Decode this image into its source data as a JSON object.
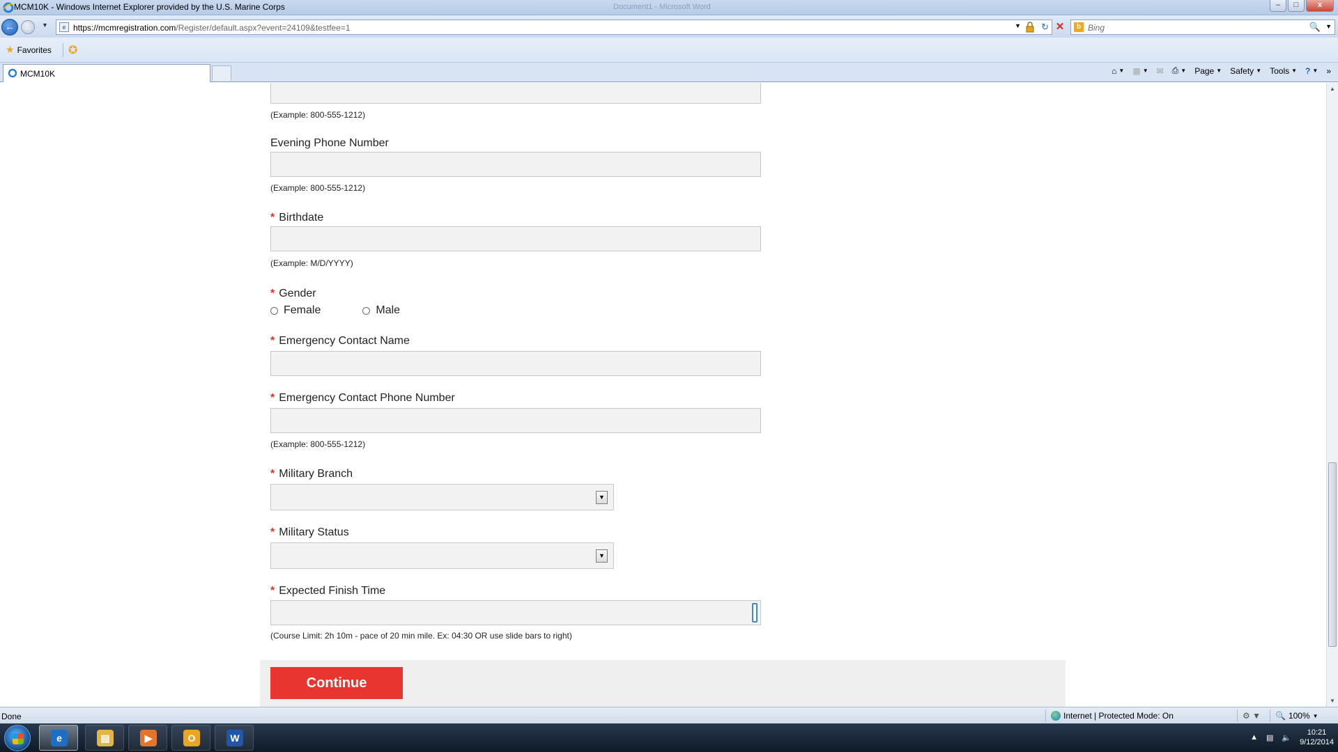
{
  "window": {
    "title": "MCM10K - Windows Internet Explorer provided by the U.S. Marine Corps",
    "ghost_title": "Document1 - Microsoft Word",
    "minimize": "–",
    "maximize": "□",
    "close": "x"
  },
  "address_bar": {
    "url_main": "https://mcmregistration.com",
    "url_rest": "/Register/default.aspx?event=24109&testfee=1",
    "search_placeholder": "Bing"
  },
  "favorites_bar": {
    "favorites_label": "Favorites"
  },
  "tabs": [
    {
      "label": "MCM10K"
    }
  ],
  "command_bar": {
    "page_label": "Page",
    "safety_label": "Safety",
    "tools_label": "Tools"
  },
  "form": {
    "phone_hint_top": "(Example: 800-555-1212)",
    "evening_phone": {
      "label": "Evening Phone Number",
      "value": "",
      "hint": "(Example: 800-555-1212)"
    },
    "birthdate": {
      "label": "Birthdate",
      "value": "",
      "hint": "(Example: M/D/YYYY)"
    },
    "gender": {
      "label": "Gender",
      "options": [
        "Female",
        "Male"
      ],
      "selected": null
    },
    "emergency_name": {
      "label": "Emergency Contact Name",
      "value": ""
    },
    "emergency_phone": {
      "label": "Emergency Contact Phone Number",
      "value": "",
      "hint": "(Example: 800-555-1212)"
    },
    "military_branch": {
      "label": "Military Branch",
      "selected": ""
    },
    "military_status": {
      "label": "Military Status",
      "selected": ""
    },
    "finish_time": {
      "label": "Expected Finish Time",
      "value": "",
      "hint": "(Course Limit: 2h 10m - pace of 20 min mile. Ex: 04:30 OR use slide bars to right)"
    },
    "required_marker": "*",
    "continue_label": "Continue"
  },
  "status_bar": {
    "status_text": "Done",
    "zone_text": "Internet | Protected Mode: On",
    "zoom": "100%"
  },
  "taskbar": {
    "time": "10:21",
    "date": "9/12/2014"
  },
  "colors": {
    "accent_red": "#e93530",
    "required_red": "#e03129"
  }
}
